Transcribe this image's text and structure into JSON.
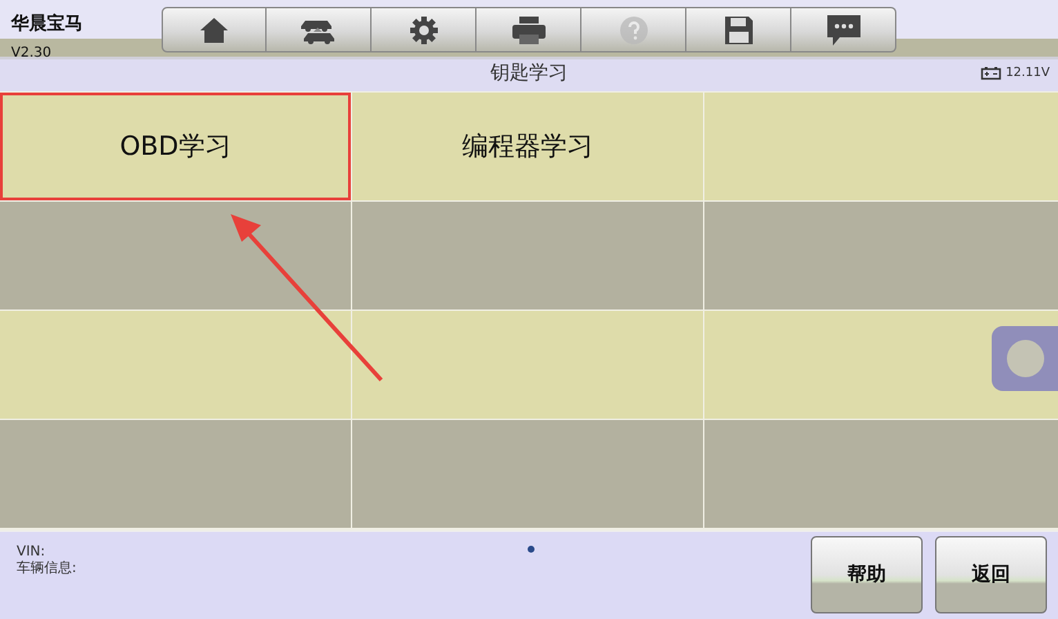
{
  "app": {
    "name": "华晨宝马",
    "version": "V2.30"
  },
  "toolbar": [
    {
      "kind": "home",
      "disabled": false
    },
    {
      "kind": "cars",
      "disabled": false
    },
    {
      "kind": "settings",
      "disabled": false
    },
    {
      "kind": "print",
      "disabled": false
    },
    {
      "kind": "help",
      "disabled": true
    },
    {
      "kind": "save",
      "disabled": false
    },
    {
      "kind": "chat",
      "disabled": false
    }
  ],
  "title_bar": {
    "title": "钥匙学习",
    "battery": "12.11V"
  },
  "grid": {
    "cells": [
      {
        "label": "OBD学习",
        "selected": true
      },
      {
        "label": "编程器学习",
        "selected": false
      },
      {
        "selected": false
      },
      {
        "selected": false
      },
      {
        "selected": false
      },
      {
        "selected": false
      },
      {
        "selected": false
      },
      {
        "selected": false
      },
      {
        "selected": false
      },
      {
        "selected": false
      },
      {
        "selected": false
      },
      {
        "selected": false
      }
    ]
  },
  "footer": {
    "vin_label": "VIN:",
    "vehicle_label": "车辆信息:",
    "buttons": [
      "帮助",
      "返回"
    ]
  }
}
